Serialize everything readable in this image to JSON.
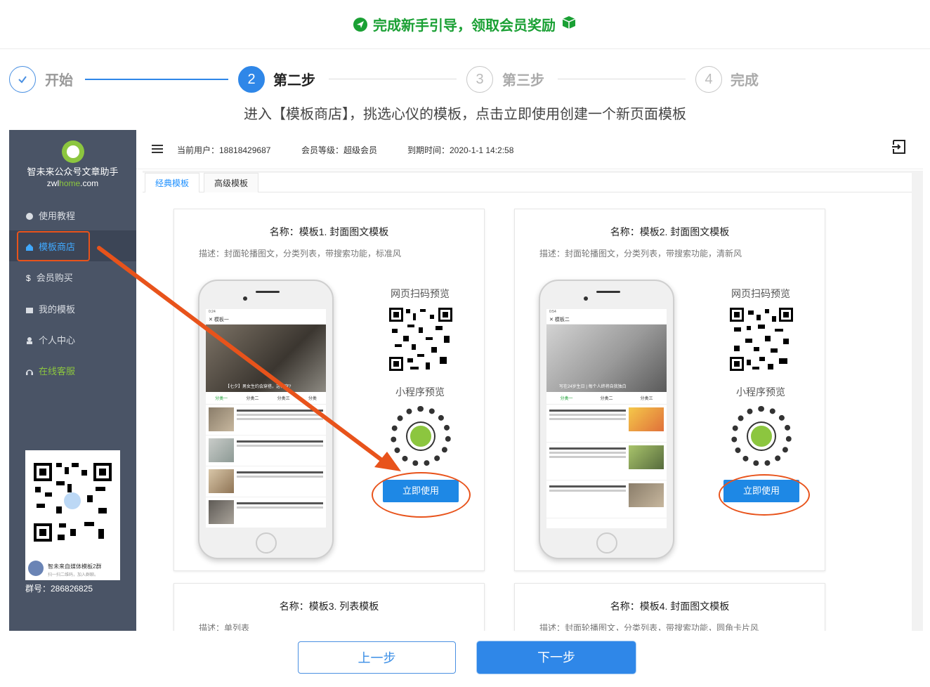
{
  "banner": {
    "title": "完成新手引导，领取会员奖励"
  },
  "steps": [
    {
      "label": "开始",
      "state": "done"
    },
    {
      "number": "2",
      "label": "第二步",
      "state": "active"
    },
    {
      "number": "3",
      "label": "第三步",
      "state": "todo"
    },
    {
      "number": "4",
      "label": "完成",
      "state": "todo"
    }
  ],
  "instruction": "进入【模板商店】，挑选心仪的模板，点击立即使用创建一个新页面模板",
  "app": {
    "brand": "智未来公众号文章助手",
    "domain_prefix": "zwl",
    "domain_mid": "home",
    "domain_suffix": ".com",
    "nav": [
      {
        "label": "使用教程",
        "icon": "help-icon"
      },
      {
        "label": "模板商店",
        "icon": "home-icon",
        "active": true
      },
      {
        "label": "会员购买",
        "icon": "dollar-icon"
      },
      {
        "label": "我的模板",
        "icon": "folder-icon"
      },
      {
        "label": "个人中心",
        "icon": "user-icon"
      },
      {
        "label": "在线客服",
        "icon": "headset-icon"
      }
    ],
    "group_name": "智未来自媒体模板2群",
    "group_hint": "扫一扫二维码，加入群聊。",
    "group_no": "群号：286826825",
    "header": {
      "user": "当前用户：18818429687",
      "level": "会员等级：超级会员",
      "expire": "到期时间：2020-1-1 14:2:58"
    },
    "tabs": [
      "经典模板",
      "高级模板"
    ],
    "cards": [
      {
        "title": "名称：模板1. 封面图文模板",
        "desc": "描述：封面轮播图文，分类列表，带搜索功能，标准风",
        "phone_title": "模板一",
        "phone_time": "0:24",
        "hero_caption": "【七夕】男女生约会穿搭，这样穿?",
        "categories": [
          "分类一",
          "分类二",
          "分类三",
          "分类"
        ],
        "scan_label": "网页扫码预览",
        "mini_label": "小程序预览",
        "use_label": "立即使用"
      },
      {
        "title": "名称：模板2. 封面图文模板",
        "desc": "描述：封面轮播图文，分类列表，带搜索功能，清新风",
        "phone_title": "模板二",
        "phone_time": "0:54",
        "hero_caption": "写在24岁生日 | 每个人终将自我独白",
        "categories": [
          "分类一",
          "分类二",
          "分类三"
        ],
        "scan_label": "网页扫码预览",
        "mini_label": "小程序预览",
        "use_label": "立即使用"
      },
      {
        "title": "名称：模板3. 列表模板",
        "desc": "描述：单列表"
      },
      {
        "title": "名称：模板4. 封面图文模板",
        "desc": "描述：封面轮播图文，分类列表，带搜索功能，圆角卡片风"
      }
    ]
  },
  "buttons": {
    "prev": "上一步",
    "next": "下一步"
  },
  "colors": {
    "accent": "#2f87e8",
    "brand_green": "#1aa034",
    "annotation": "#e8531b",
    "sidebar": "#4a5466"
  }
}
